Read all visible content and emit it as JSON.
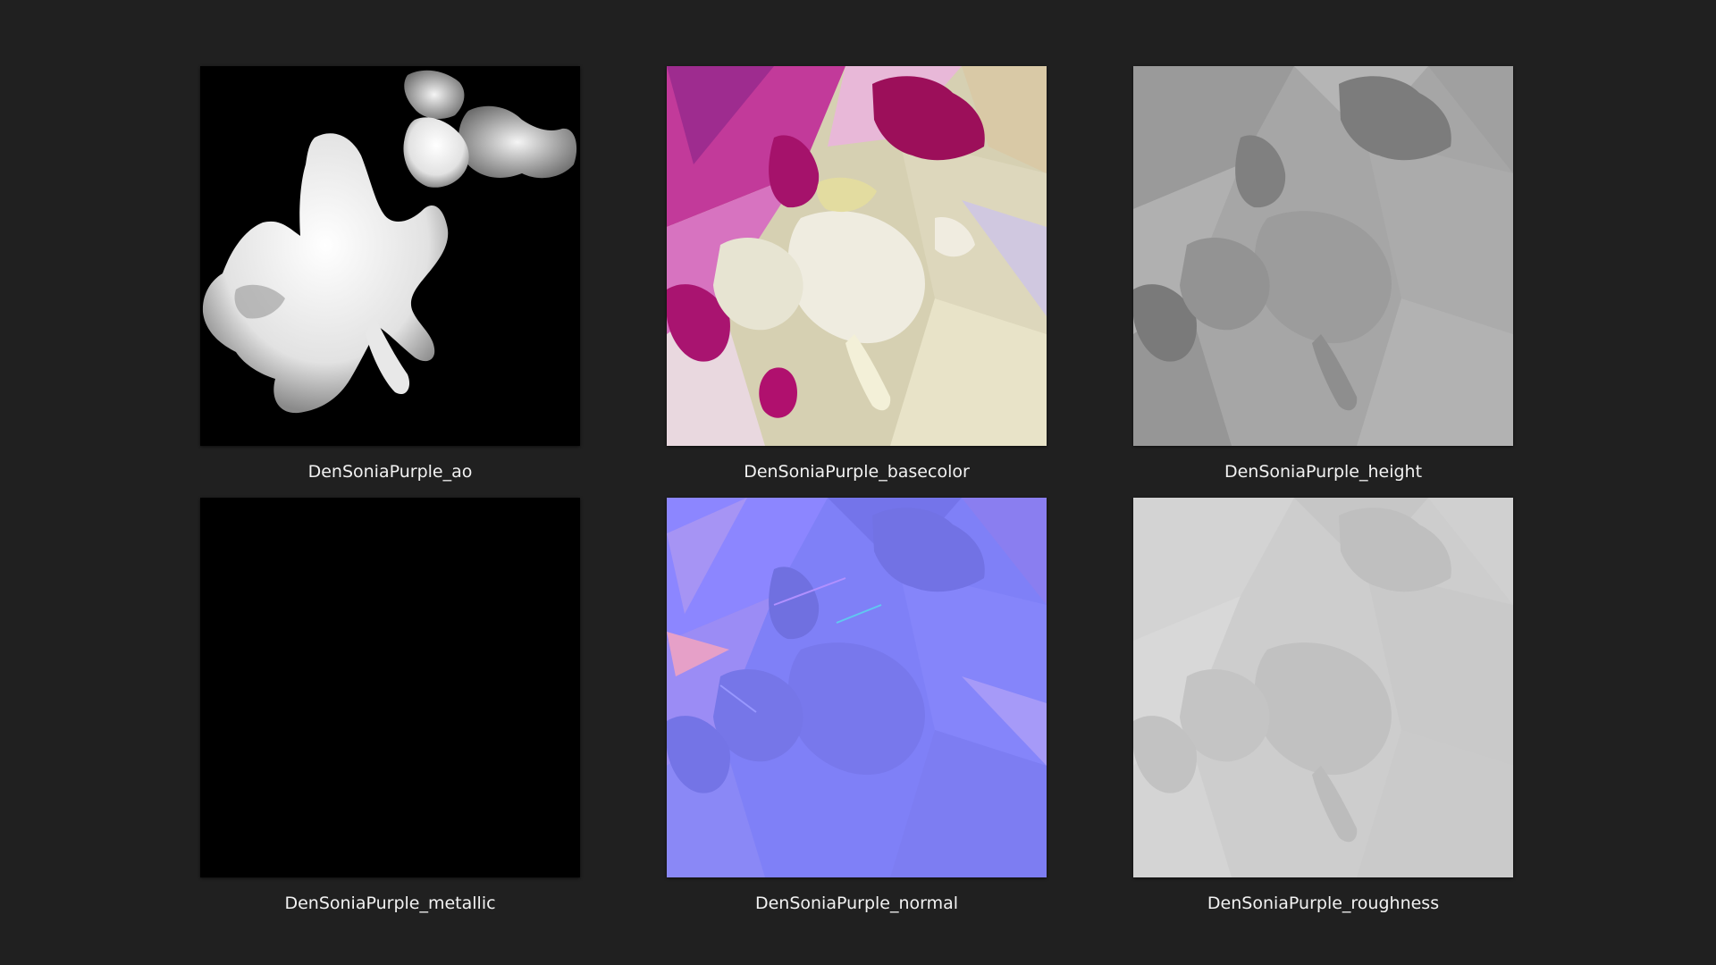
{
  "thumbnails": [
    {
      "label": "DenSoniaPurple_ao",
      "map": "ao",
      "colors": {
        "bg": "#000000",
        "fg": "#f0f0f0"
      }
    },
    {
      "label": "DenSoniaPurple_basecolor",
      "map": "basecolor",
      "colors": {
        "bg": "#d8d2b4",
        "accent": "#b0106e",
        "light": "#f1f0e4"
      }
    },
    {
      "label": "DenSoniaPurple_height",
      "map": "height",
      "colors": {
        "bg": "#a9a9a9",
        "dark": "#7a7a7a",
        "light": "#c8c8c8"
      }
    },
    {
      "label": "DenSoniaPurple_metallic",
      "map": "metallic",
      "colors": {
        "bg": "#000000"
      }
    },
    {
      "label": "DenSoniaPurple_normal",
      "map": "normal",
      "colors": {
        "bg": "#8080ff",
        "dark": "#6c6ce6",
        "light": "#b0a8ff"
      }
    },
    {
      "label": "DenSoniaPurple_roughness",
      "map": "roughness",
      "colors": {
        "bg": "#cfcfcf",
        "dark": "#bdbdbd",
        "light": "#dedede"
      }
    }
  ]
}
